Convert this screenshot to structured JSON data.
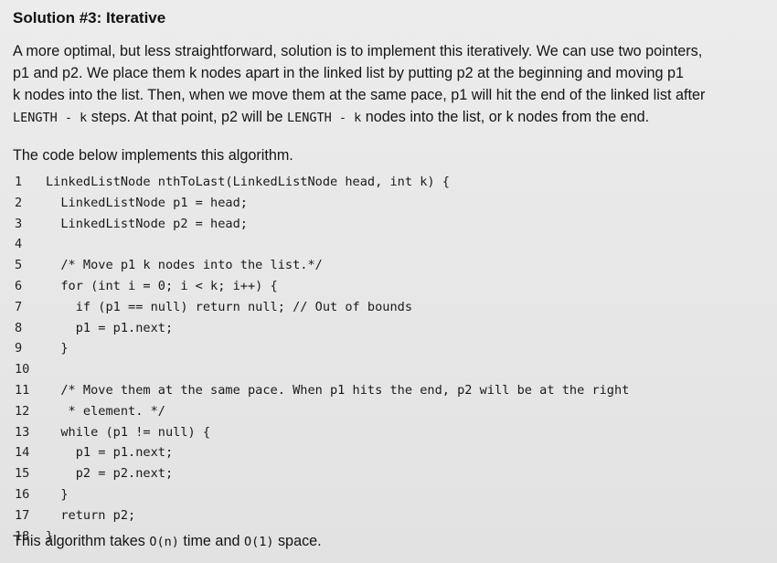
{
  "heading": "Solution #3: Iterative",
  "intro": {
    "line1": "A more optimal, but less straightforward, solution is to implement this iteratively. We can use two pointers,",
    "line2": "p1 and p2. We place them k nodes apart in the linked list by putting p2 at the beginning and moving p1",
    "line3": "k nodes into the list. Then, when we move them at the same pace, p1 will hit the end of the linked list after",
    "line4_code1": "LENGTH - k",
    "line4_text1": " steps. At that point, p2  will be ",
    "line4_code2": "LENGTH - k",
    "line4_text2": " nodes into the list, or k nodes from the end."
  },
  "code_intro": "The code below implements this algorithm.",
  "code_lines": [
    {
      "num": "1",
      "text": "LinkedListNode nthToLast(LinkedListNode head, int k) {"
    },
    {
      "num": "2",
      "text": "  LinkedListNode p1 = head;"
    },
    {
      "num": "3",
      "text": "  LinkedListNode p2 = head;"
    },
    {
      "num": "4",
      "text": ""
    },
    {
      "num": "5",
      "text": "  /* Move p1 k nodes into the list.*/"
    },
    {
      "num": "6",
      "text": "  for (int i = 0; i < k; i++) {"
    },
    {
      "num": "7",
      "text": "    if (p1 == null) return null; // Out of bounds"
    },
    {
      "num": "8",
      "text": "    p1 = p1.next;"
    },
    {
      "num": "9",
      "text": "  }"
    },
    {
      "num": "10",
      "text": ""
    },
    {
      "num": "11",
      "text": "  /* Move them at the same pace. When p1 hits the end, p2 will be at the right"
    },
    {
      "num": "12",
      "text": "   * element. */"
    },
    {
      "num": "13",
      "text": "  while (p1 != null) {"
    },
    {
      "num": "14",
      "text": "    p1 = p1.next;"
    },
    {
      "num": "15",
      "text": "    p2 = p2.next;"
    },
    {
      "num": "16",
      "text": "  }"
    },
    {
      "num": "17",
      "text": "  return p2;"
    },
    {
      "num": "18",
      "text": "}"
    }
  ],
  "conclusion": {
    "text1": "This algorithm takes ",
    "code1": "O(n)",
    "text2": " time and ",
    "code2": "O(1)",
    "text3": " space."
  }
}
